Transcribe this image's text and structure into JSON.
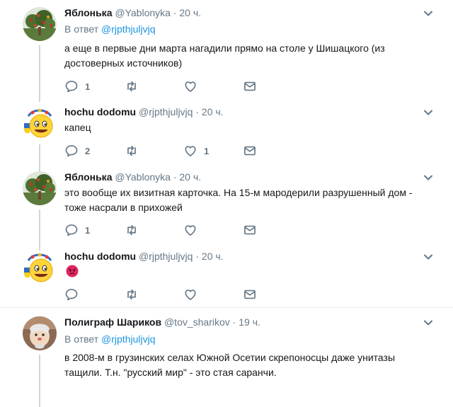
{
  "tweets": [
    {
      "name": "Яблонька",
      "handle": "@Yablonyka",
      "time": "20 ч.",
      "reply_prefix": "В ответ",
      "reply_to": "@rjpthjuljvjq",
      "text": "а еще в первые дни  марта нагадили прямо на столе у Шишацкого (из достоверных источников)",
      "replies": "1",
      "retweets": "",
      "likes": ""
    },
    {
      "name": "hochu dodomu",
      "handle": "@rjpthjuljvjq",
      "time": "20 ч.",
      "text": "капец",
      "replies": "2",
      "retweets": "",
      "likes": "1"
    },
    {
      "name": "Яблонька",
      "handle": "@Yablonyka",
      "time": "20 ч.",
      "text": "это вообще их визитная карточка. На 15-м мародерили разрушенный дом - тоже насрали в прихожей",
      "replies": "1",
      "retweets": "",
      "likes": ""
    },
    {
      "name": "hochu dodomu",
      "handle": "@rjpthjuljvjq",
      "time": "20 ч.",
      "text": "",
      "replies": "",
      "retweets": "",
      "likes": ""
    },
    {
      "name": "Полиграф Шариков",
      "handle": "@tov_sharikov",
      "time": "19 ч.",
      "reply_prefix": "В ответ",
      "reply_to": "@rjpthjuljvjq",
      "text": "в 2008-м в грузинских селах Южной Осетии скрепоносцы даже унитазы тащили. Т.н. \"русский мир\" - это стая саранчи."
    }
  ],
  "separator": "·",
  "colors": {
    "link": "#1b95e0",
    "muted": "#657786",
    "thread_line": "#ccd6dd",
    "angry_emoji": "#e0245e"
  },
  "icons": [
    "reply-icon",
    "retweet-icon",
    "heart-icon",
    "dm-icon",
    "chevron-down-icon",
    "angry-face-emoji"
  ]
}
